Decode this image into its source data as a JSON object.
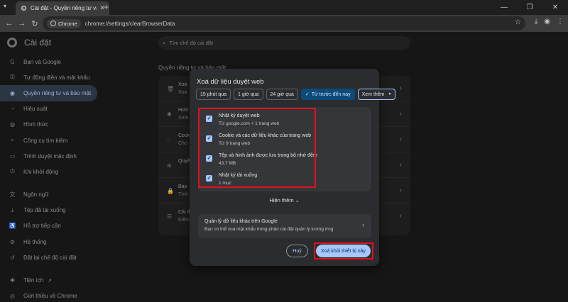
{
  "browser": {
    "tab_title": "Cài đặt - Quyền riêng tư và bảo",
    "new_tab_label": "+",
    "chip_label": "Chrome",
    "url": "chrome://settings/clearBrowserData"
  },
  "settings": {
    "title": "Cài đặt",
    "search_placeholder": "Tìm chế độ cài đặt",
    "section_title": "Quyền riêng tư và bảo mật",
    "sidebar": [
      {
        "label": "Bạn và Google",
        "icon": "google-icon"
      },
      {
        "label": "Tự động điền và mật khẩu",
        "icon": "autofill-icon"
      },
      {
        "label": "Quyền riêng tư và bảo mật",
        "icon": "shield-icon",
        "active": true
      },
      {
        "label": "Hiệu suất",
        "icon": "speed-icon"
      },
      {
        "label": "Hình thức",
        "icon": "palette-icon"
      },
      {
        "label": "Công cụ tìm kiếm",
        "icon": "search-icon"
      },
      {
        "label": "Trình duyệt mặc định",
        "icon": "browser-icon"
      },
      {
        "label": "Khi khởi động",
        "icon": "power-icon"
      },
      {
        "label": "Ngôn ngữ",
        "icon": "language-icon"
      },
      {
        "label": "Tệp đã tải xuống",
        "icon": "download-icon"
      },
      {
        "label": "Hỗ trợ tiếp cận",
        "icon": "accessibility-icon"
      },
      {
        "label": "Hệ thống",
        "icon": "wrench-icon"
      },
      {
        "label": "Đặt lại chế độ cài đặt",
        "icon": "reset-icon"
      },
      {
        "label": "Tiện ích",
        "icon": "extension-icon"
      },
      {
        "label": "Giới thiệu về Chrome",
        "icon": "chrome-icon"
      }
    ],
    "rows": [
      {
        "title": "Xoá",
        "sub": "Xoá"
      },
      {
        "title": "Hướ",
        "sub": "Xem"
      },
      {
        "title": "Cook",
        "sub": "Cho"
      },
      {
        "title": "Quyề",
        "sub": ""
      },
      {
        "title": "Bảo",
        "sub": "Tính"
      },
      {
        "title": "Cài đ",
        "sub": "Kiểm"
      }
    ]
  },
  "dialog": {
    "title": "Xoá dữ liệu duyệt web",
    "periods": [
      "15 phút qua",
      "1 giờ qua",
      "24 giờ qua",
      "Từ trước đến nay"
    ],
    "more_label": "Xem thêm",
    "items": [
      {
        "title": "Nhật ký duyệt web",
        "sub": "Từ google.com + 1 trang web",
        "checked": true
      },
      {
        "title": "Cookie và các dữ liệu khác của trang web",
        "sub": "Từ 9 trang web",
        "checked": true
      },
      {
        "title": "Tệp và hình ảnh được lưu trong bộ nhớ đệm",
        "sub": "43,7 MB",
        "checked": true
      },
      {
        "title": "Nhật ký tải xuống",
        "sub": "1 mục",
        "checked": true
      }
    ],
    "show_more": "Hiện thêm",
    "google_title": "Quản lý dữ liệu khác trên Google",
    "google_sub": "Bạn có thể xoá mật khẩu trong phần cài đặt quản lý tương ứng",
    "cancel": "Huỷ",
    "confirm": "Xoá khỏi thiết bị này"
  }
}
